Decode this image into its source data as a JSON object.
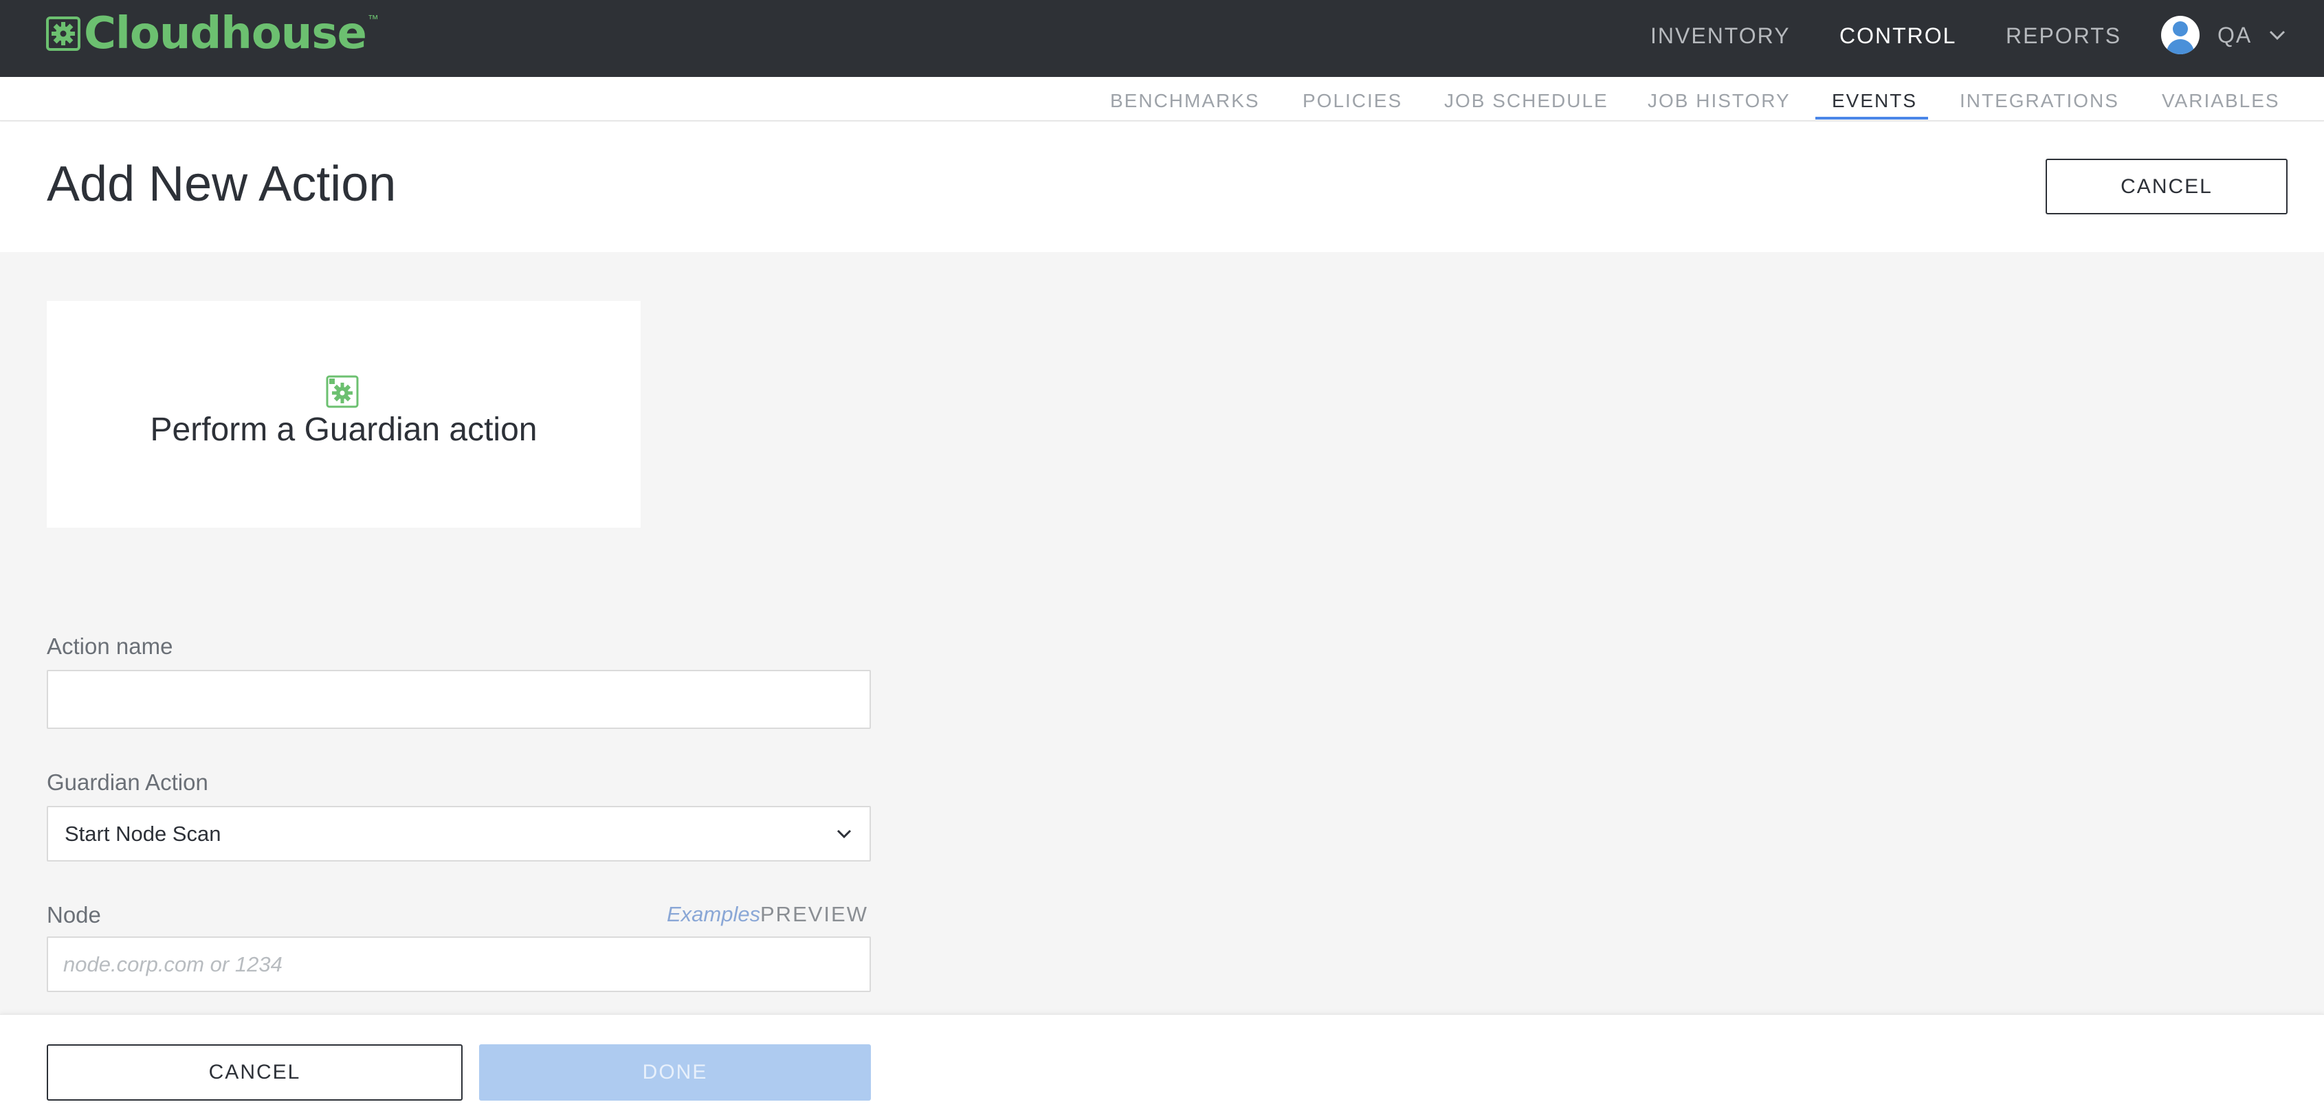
{
  "app": {
    "brand": "Cloudhouse",
    "trademark": "™",
    "brand_color": "#6cc070"
  },
  "topnav": {
    "items": [
      {
        "label": "INVENTORY",
        "active": false
      },
      {
        "label": "CONTROL",
        "active": true
      },
      {
        "label": "REPORTS",
        "active": false
      }
    ],
    "user_label": "QA"
  },
  "subnav": {
    "items": [
      {
        "label": "BENCHMARKS",
        "active": false
      },
      {
        "label": "POLICIES",
        "active": false
      },
      {
        "label": "JOB SCHEDULE",
        "active": false
      },
      {
        "label": "JOB HISTORY",
        "active": false
      },
      {
        "label": "EVENTS",
        "active": true
      },
      {
        "label": "INTEGRATIONS",
        "active": false
      },
      {
        "label": "VARIABLES",
        "active": false
      }
    ],
    "accent_color": "#4a86e8"
  },
  "header": {
    "title": "Add New Action",
    "cancel_label": "CANCEL"
  },
  "action_card": {
    "icon": "guardian-gear-icon",
    "title": "Perform a Guardian action"
  },
  "form": {
    "action_name": {
      "label": "Action name",
      "value": "",
      "placeholder": ""
    },
    "guardian_action": {
      "label": "Guardian Action",
      "selected": "Start Node Scan"
    },
    "node": {
      "label": "Node",
      "value": "",
      "placeholder": "node.corp.com or 1234",
      "examples_label": "Examples",
      "preview_label": "PREVIEW"
    }
  },
  "footer": {
    "cancel_label": "CANCEL",
    "done_label": "DONE",
    "done_disabled": true
  }
}
